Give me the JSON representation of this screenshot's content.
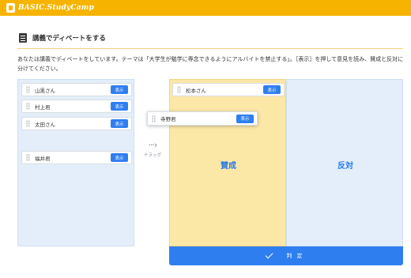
{
  "app": {
    "logo_text": "BASIC.StudyCamp"
  },
  "page": {
    "title": "講義でディベートをする",
    "instructions": "あなたは講義でディベートをしています。テーマは「大学生が勉学に専念できるようにアルバイトを禁止する」。［表示］を押して意見を読み、賛成と反対に分けてください。"
  },
  "show_label": "表示",
  "pool": {
    "cards": [
      {
        "name": "山黒さん"
      },
      {
        "name": "村上君"
      },
      {
        "name": "太田さん"
      },
      {
        "name": "福井君"
      }
    ]
  },
  "drag_hint": {
    "label": "ドラッグ"
  },
  "dragging_card": {
    "name": "寺野君"
  },
  "board": {
    "pro": {
      "label": "賛成",
      "cards": [
        {
          "name": "松本さん"
        }
      ]
    },
    "con": {
      "label": "反対"
    }
  },
  "judge_button": {
    "label": "判定"
  },
  "colors": {
    "brand": "#f6b400",
    "accent": "#2f7ef0",
    "pro_bg": "#fbe7a6",
    "con_bg": "#e3eefa"
  }
}
